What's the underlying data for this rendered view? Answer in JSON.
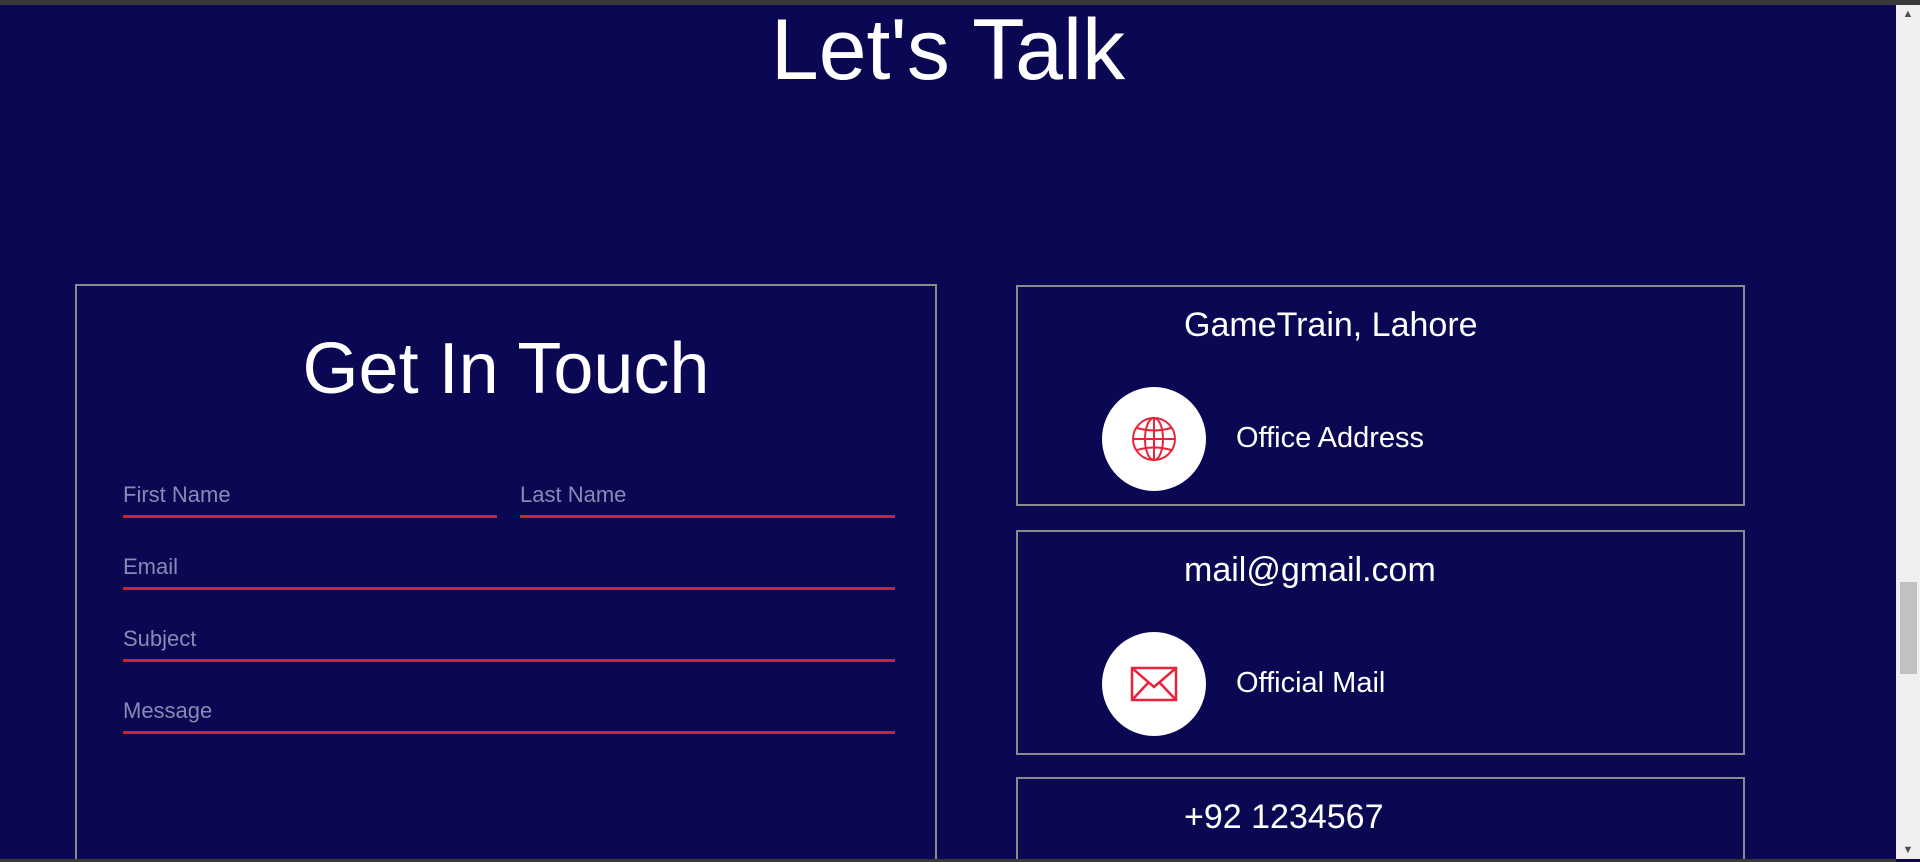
{
  "section": {
    "title": "Let's Talk"
  },
  "form": {
    "title": "Get In Touch",
    "first_name_placeholder": "First Name",
    "last_name_placeholder": "Last Name",
    "email_placeholder": "Email",
    "subject_placeholder": "Subject",
    "message_placeholder": "Message"
  },
  "contacts": [
    {
      "value": "GameTrain, Lahore",
      "label": "Office Address",
      "icon": "globe-icon"
    },
    {
      "value": "mail@gmail.com",
      "label": "Official Mail",
      "icon": "envelope-icon"
    },
    {
      "value": "+92 1234567",
      "label": "",
      "icon": ""
    }
  ],
  "colors": {
    "background": "#0a0753",
    "accent": "#c9272f",
    "card_border": "#8a8a8a",
    "icon_color": "#e8233a"
  }
}
